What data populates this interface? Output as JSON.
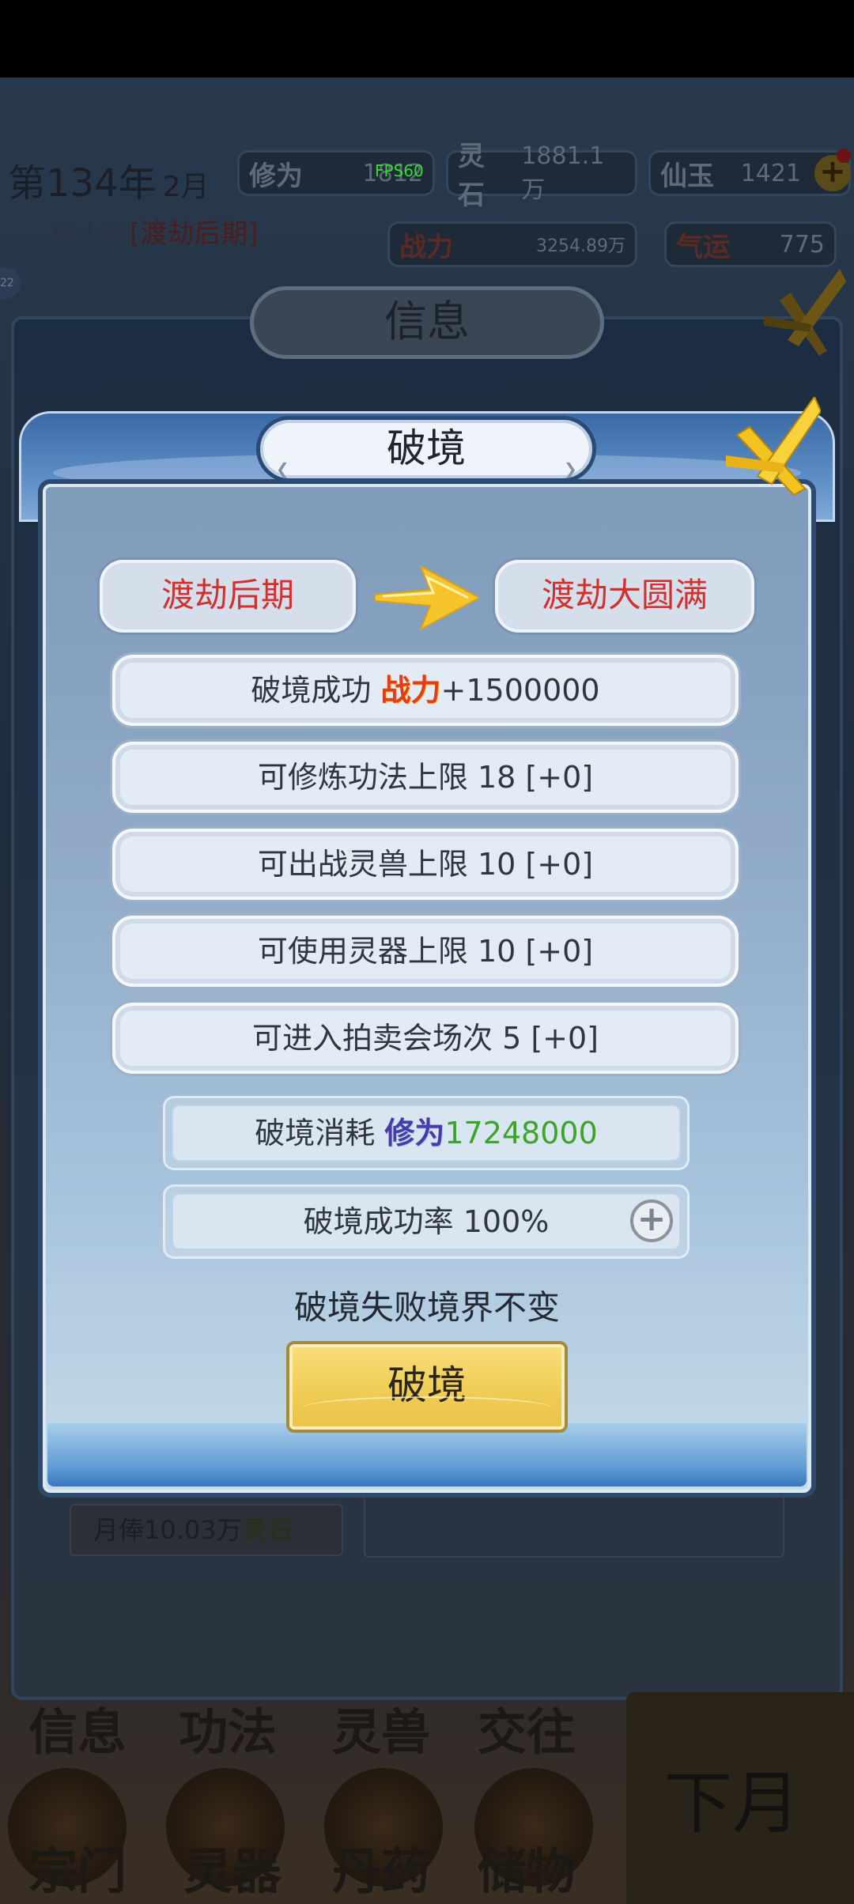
{
  "status_bar": {
    "year_label": "第134年",
    "month_label": "2月",
    "fps": "FPS60"
  },
  "resources": {
    "xiuwei": {
      "label": "修为",
      "value": "1812"
    },
    "lingshi": {
      "label": "灵石",
      "value": "1881.1万"
    },
    "xianyu": {
      "label": "仙玉",
      "value": "1421"
    },
    "zhanli": {
      "label": "战力",
      "value": "3254.89万"
    },
    "qiyun": {
      "label": "气运",
      "value": "775"
    }
  },
  "player": {
    "name": "林小雅",
    "realm_open": "[",
    "realm": "渡劫后期",
    "realm_close": "]",
    "side_badge": "22"
  },
  "info_panel": {
    "title": "信息",
    "salary_label": "月俸10.03万",
    "salary_currency": "灵石"
  },
  "bottom_nav": {
    "row1": [
      "信息",
      "功法",
      "灵兽",
      "交往"
    ],
    "row2": [
      "宗门",
      "灵器",
      "丹药",
      "储物"
    ],
    "next_month": "下月"
  },
  "breakthrough": {
    "title": "破境",
    "from_realm": "渡劫后期",
    "to_realm": "渡劫大圆满",
    "effects": [
      {
        "prefix": "破境成功 ",
        "keyword": "战力",
        "suffix": "+1500000"
      },
      {
        "prefix": "可修炼功法上限 18 [+0]"
      },
      {
        "prefix": "可出战灵兽上限 10 [+0]"
      },
      {
        "prefix": "可使用灵器上限 10 [+0]"
      },
      {
        "prefix": "可进入拍卖会场次 5 [+0]"
      }
    ],
    "cost_label": "破境消耗 ",
    "cost_keyword": "修为",
    "cost_value": "17248000",
    "success_rate": "破境成功率 100%",
    "plus_symbol": "+",
    "fail_note": "破境失败境界不变",
    "button_label": "破境"
  },
  "colors": {
    "realm_red": "#d22f2f",
    "cost_green": "#3aa52a",
    "button_gold": "#f0cd55",
    "frame_blue": "#2d4a6e"
  },
  "icons": {
    "close": "close-x-icon",
    "arrow": "arrow-right-icon",
    "plus": "plus-circle-icon",
    "coin_plus": "plus-coin-icon"
  }
}
